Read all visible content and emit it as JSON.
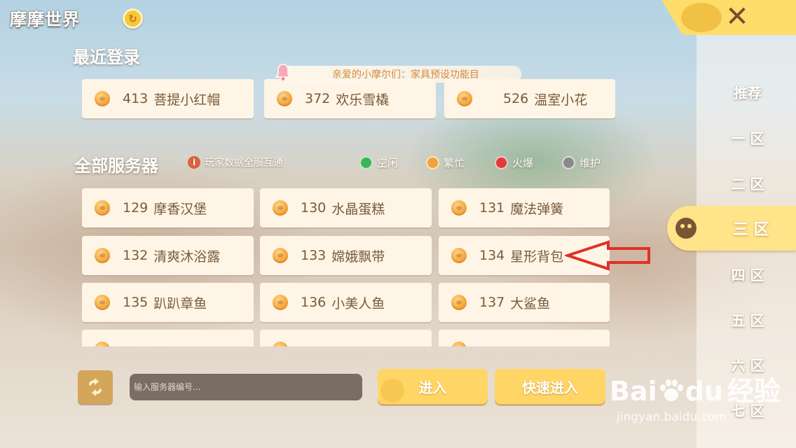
{
  "app": {
    "title": "摩摩世界",
    "badge_icon": "refresh-coin-icon"
  },
  "recent": {
    "heading": "最近登录",
    "servers": [
      {
        "num": "413",
        "name": "菩提小红帽"
      },
      {
        "num": "372",
        "name": "欢乐雪橇"
      },
      {
        "num": "526",
        "name": "温室小花"
      }
    ]
  },
  "notice": {
    "text": "亲爱的小摩尔们：家具预设功能目"
  },
  "all_servers": {
    "heading": "全部服务器",
    "hint": "玩家数据全服互通",
    "legend": [
      {
        "label": "空闲",
        "color": "#3cb55a"
      },
      {
        "label": "繁忙",
        "color": "#f2a23a"
      },
      {
        "label": "火爆",
        "color": "#e03c3c"
      },
      {
        "label": "维护",
        "color": "#8a8a8a"
      }
    ],
    "servers": [
      {
        "num": "129",
        "name": "摩香汉堡"
      },
      {
        "num": "130",
        "name": "水晶蛋糕"
      },
      {
        "num": "131",
        "name": "魔法弹簧"
      },
      {
        "num": "132",
        "name": "清爽沐浴露"
      },
      {
        "num": "133",
        "name": "嫦娥飘带"
      },
      {
        "num": "134",
        "name": "星形背包"
      },
      {
        "num": "135",
        "name": "趴趴章鱼"
      },
      {
        "num": "136",
        "name": "小美人鱼"
      },
      {
        "num": "137",
        "name": "大鲨鱼"
      },
      {
        "num": "",
        "name": ""
      },
      {
        "num": "",
        "name": ""
      },
      {
        "num": "",
        "name": ""
      }
    ]
  },
  "bottom": {
    "input_placeholder": "输入服务器编号...",
    "enter_label": "进入",
    "quick_enter_label": "快速进入"
  },
  "nav": {
    "items": [
      "推荐",
      "一 区",
      "二 区",
      "三 区",
      "四 区",
      "五 区",
      "六 区",
      "七 区"
    ],
    "active_index": 3,
    "close_label": "✕"
  },
  "watermark": {
    "brand": "Bai",
    "brand2": "du",
    "cn": "经验",
    "url": "jingyan.baidu.com"
  },
  "colors": {
    "accent": "#ffd665",
    "card_bg": "#fff5e6",
    "card_text": "#7a5a3a",
    "arrow": "#e0302a"
  }
}
